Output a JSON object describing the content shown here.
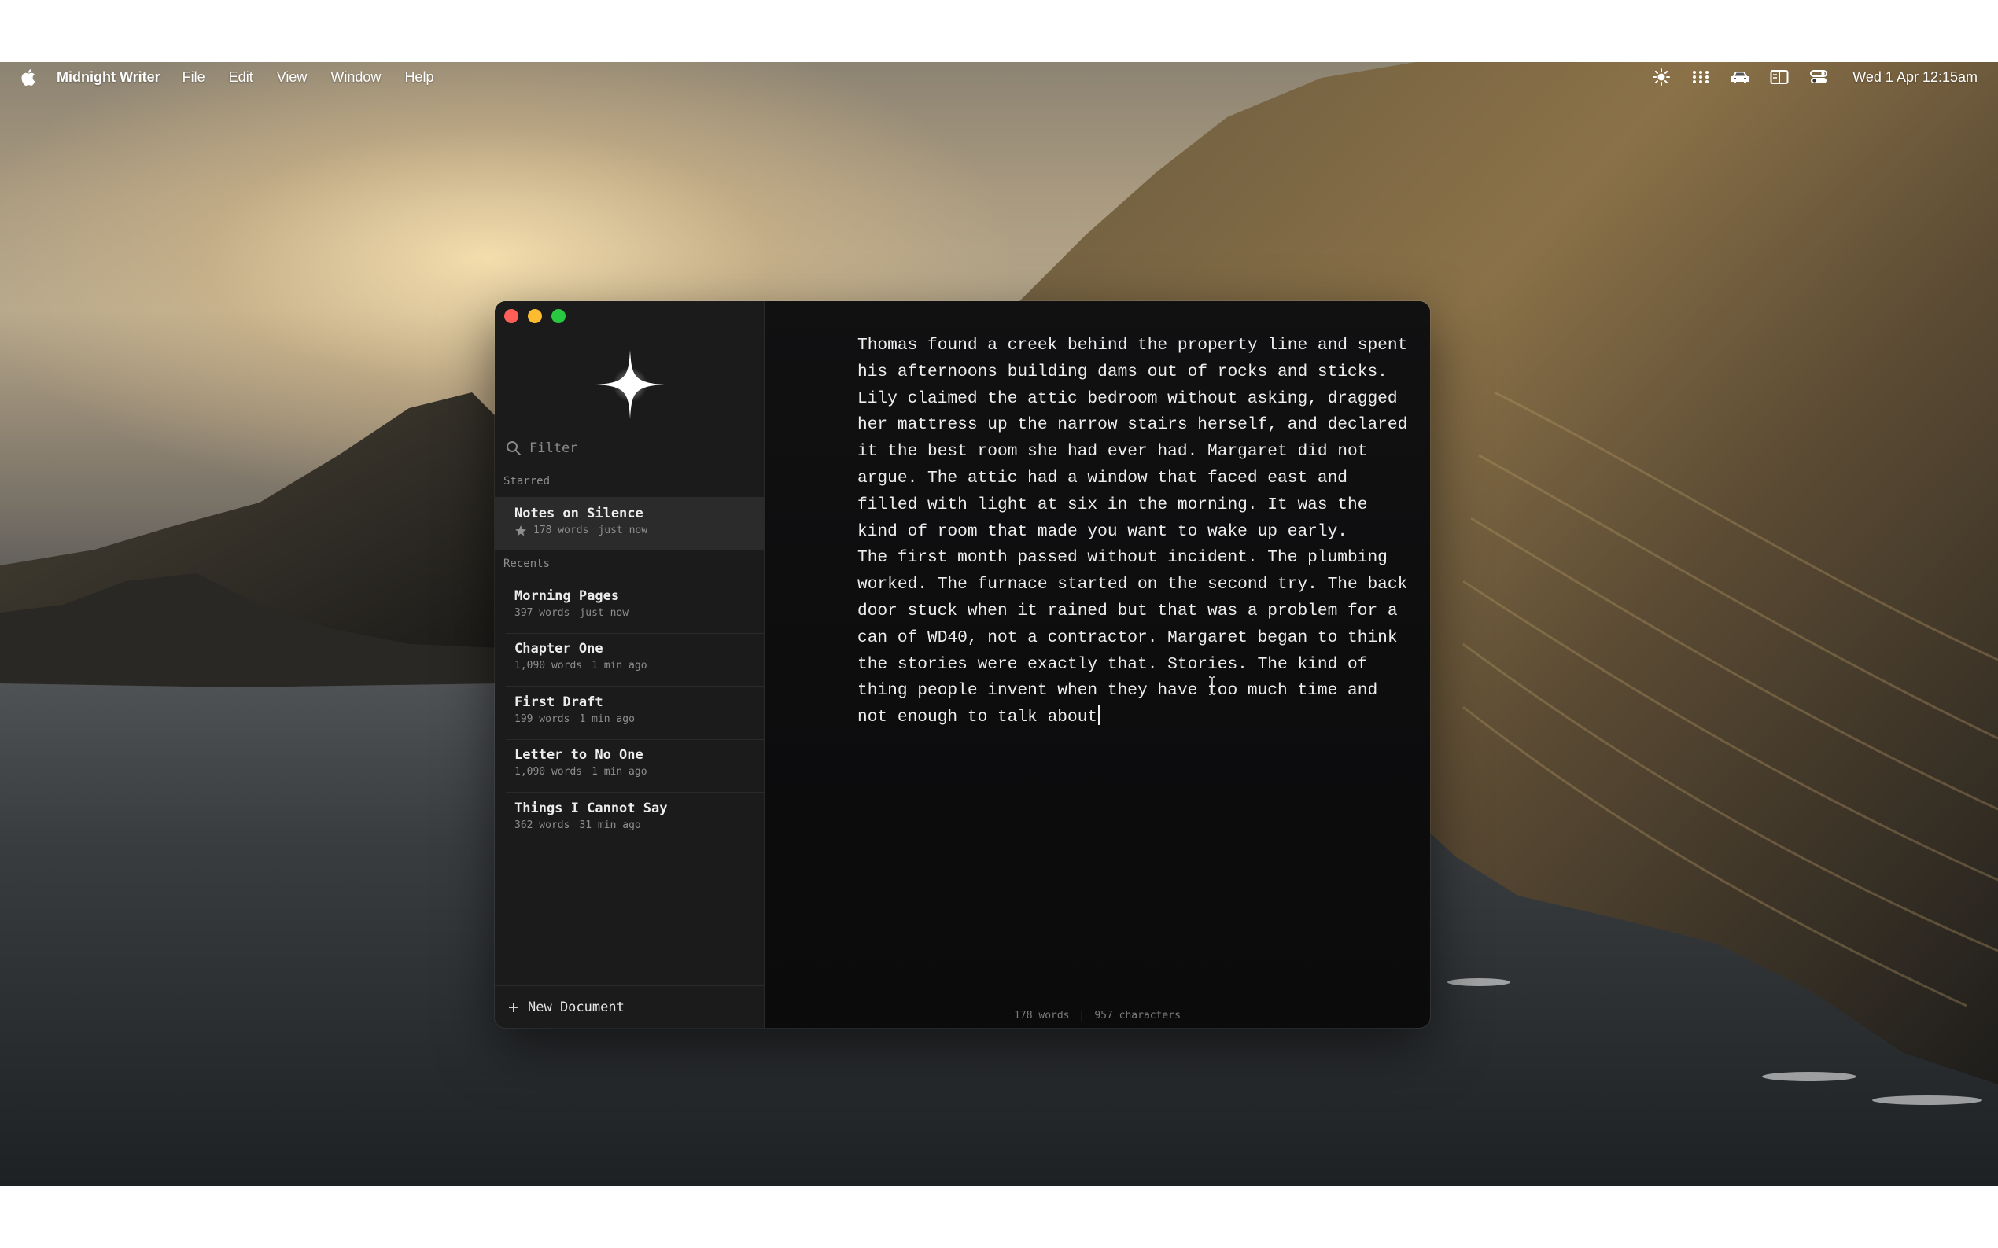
{
  "menubar": {
    "apple_icon": "apple-logo-icon",
    "app_name": "Midnight Writer",
    "menus": [
      "File",
      "Edit",
      "View",
      "Window",
      "Help"
    ],
    "tray_icons": [
      "brightness-icon",
      "grid-dots-icon",
      "car-icon",
      "reader-split-icon",
      "control-center-icon"
    ],
    "clock": "Wed 1 Apr  12:15am"
  },
  "sidebar": {
    "logo_icon": "sparkle-star-icon",
    "filter_placeholder": "Filter",
    "starred_label": "Starred",
    "recents_label": "Recents",
    "starred": [
      {
        "title": "Notes on Silence",
        "words": "178 words",
        "time": "just now",
        "starred": true
      }
    ],
    "recents": [
      {
        "title": "Morning Pages",
        "words": "397 words",
        "time": "just now"
      },
      {
        "title": "Chapter One",
        "words": "1,090 words",
        "time": "1 min ago"
      },
      {
        "title": "First Draft",
        "words": "199 words",
        "time": "1 min ago"
      },
      {
        "title": "Letter to No One",
        "words": "1,090 words",
        "time": "1 min ago"
      },
      {
        "title": "Things I Cannot Say",
        "words": "362 words",
        "time": "31 min ago"
      }
    ],
    "new_document_label": "New Document"
  },
  "editor": {
    "paragraphs": [
      "Thomas found a creek behind the property line and spent his afternoons building dams out of rocks and sticks. Lily claimed the attic bedroom without asking, dragged her mattress up the narrow stairs herself, and declared it the best room she had ever had. Margaret did not argue. The attic had a window that faced east and filled with light at six in the morning. It was the kind of room that made you want to wake up early.",
      "The first month passed without incident. The plumbing worked. The furnace started on the second try. The back door stuck when it rained but that was a problem for a can of WD40, not a contractor. Margaret began to think the stories were exactly that. Stories. The kind of thing people invent when they have too much time and not enough to talk about"
    ],
    "word_count": "178 words",
    "separator": "|",
    "char_count": "957 characters"
  },
  "colors": {
    "close": "#ff5f57",
    "minimize": "#febc2e",
    "zoom": "#28c840",
    "sidebar_bg": "#1b1b1c",
    "editor_bg": "#0e0e0f",
    "selected_row": "#2b2b2c"
  }
}
